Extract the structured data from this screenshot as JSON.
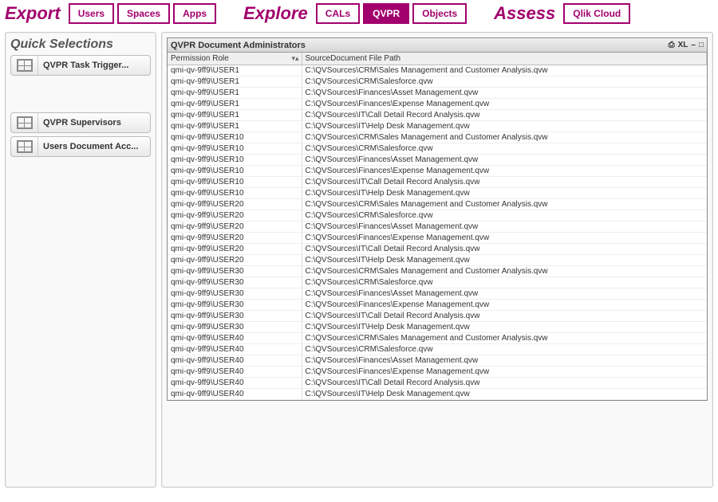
{
  "topbar": {
    "sections": [
      {
        "label": "Export",
        "buttons": [
          {
            "label": "Users",
            "active": false
          },
          {
            "label": "Spaces",
            "active": false
          },
          {
            "label": "Apps",
            "active": false
          }
        ]
      },
      {
        "label": "Explore",
        "buttons": [
          {
            "label": "CALs",
            "active": false
          },
          {
            "label": "QVPR",
            "active": true
          },
          {
            "label": "Objects",
            "active": false
          }
        ]
      },
      {
        "label": "Assess",
        "buttons": [
          {
            "label": "Qlik Cloud",
            "active": false
          }
        ]
      }
    ]
  },
  "sidebar": {
    "title": "Quick Selections",
    "items": [
      {
        "label": "QVPR Task Trigger..."
      },
      {
        "label": "QVPR Supervisors"
      },
      {
        "label": "Users Document Acc..."
      }
    ]
  },
  "table": {
    "title": "QVPR Document Administrators",
    "tools": [
      "⎙",
      "XL",
      "–",
      "□"
    ],
    "columns": [
      {
        "label": "Permission Role"
      },
      {
        "label": "SourceDocument File Path"
      }
    ],
    "rows": [
      [
        "qmi-qv-9ff9\\USER1",
        "C:\\QVSources\\CRM\\Sales Management and Customer Analysis.qvw"
      ],
      [
        "qmi-qv-9ff9\\USER1",
        "C:\\QVSources\\CRM\\Salesforce.qvw"
      ],
      [
        "qmi-qv-9ff9\\USER1",
        "C:\\QVSources\\Finances\\Asset Management.qvw"
      ],
      [
        "qmi-qv-9ff9\\USER1",
        "C:\\QVSources\\Finances\\Expense Management.qvw"
      ],
      [
        "qmi-qv-9ff9\\USER1",
        "C:\\QVSources\\IT\\Call Detail Record Analysis.qvw"
      ],
      [
        "qmi-qv-9ff9\\USER1",
        "C:\\QVSources\\IT\\Help Desk Management.qvw"
      ],
      [
        "qmi-qv-9ff9\\USER10",
        "C:\\QVSources\\CRM\\Sales Management and Customer Analysis.qvw"
      ],
      [
        "qmi-qv-9ff9\\USER10",
        "C:\\QVSources\\CRM\\Salesforce.qvw"
      ],
      [
        "qmi-qv-9ff9\\USER10",
        "C:\\QVSources\\Finances\\Asset Management.qvw"
      ],
      [
        "qmi-qv-9ff9\\USER10",
        "C:\\QVSources\\Finances\\Expense Management.qvw"
      ],
      [
        "qmi-qv-9ff9\\USER10",
        "C:\\QVSources\\IT\\Call Detail Record Analysis.qvw"
      ],
      [
        "qmi-qv-9ff9\\USER10",
        "C:\\QVSources\\IT\\Help Desk Management.qvw"
      ],
      [
        "qmi-qv-9ff9\\USER20",
        "C:\\QVSources\\CRM\\Sales Management and Customer Analysis.qvw"
      ],
      [
        "qmi-qv-9ff9\\USER20",
        "C:\\QVSources\\CRM\\Salesforce.qvw"
      ],
      [
        "qmi-qv-9ff9\\USER20",
        "C:\\QVSources\\Finances\\Asset Management.qvw"
      ],
      [
        "qmi-qv-9ff9\\USER20",
        "C:\\QVSources\\Finances\\Expense Management.qvw"
      ],
      [
        "qmi-qv-9ff9\\USER20",
        "C:\\QVSources\\IT\\Call Detail Record Analysis.qvw"
      ],
      [
        "qmi-qv-9ff9\\USER20",
        "C:\\QVSources\\IT\\Help Desk Management.qvw"
      ],
      [
        "qmi-qv-9ff9\\USER30",
        "C:\\QVSources\\CRM\\Sales Management and Customer Analysis.qvw"
      ],
      [
        "qmi-qv-9ff9\\USER30",
        "C:\\QVSources\\CRM\\Salesforce.qvw"
      ],
      [
        "qmi-qv-9ff9\\USER30",
        "C:\\QVSources\\Finances\\Asset Management.qvw"
      ],
      [
        "qmi-qv-9ff9\\USER30",
        "C:\\QVSources\\Finances\\Expense Management.qvw"
      ],
      [
        "qmi-qv-9ff9\\USER30",
        "C:\\QVSources\\IT\\Call Detail Record Analysis.qvw"
      ],
      [
        "qmi-qv-9ff9\\USER30",
        "C:\\QVSources\\IT\\Help Desk Management.qvw"
      ],
      [
        "qmi-qv-9ff9\\USER40",
        "C:\\QVSources\\CRM\\Sales Management and Customer Analysis.qvw"
      ],
      [
        "qmi-qv-9ff9\\USER40",
        "C:\\QVSources\\CRM\\Salesforce.qvw"
      ],
      [
        "qmi-qv-9ff9\\USER40",
        "C:\\QVSources\\Finances\\Asset Management.qvw"
      ],
      [
        "qmi-qv-9ff9\\USER40",
        "C:\\QVSources\\Finances\\Expense Management.qvw"
      ],
      [
        "qmi-qv-9ff9\\USER40",
        "C:\\QVSources\\IT\\Call Detail Record Analysis.qvw"
      ],
      [
        "qmi-qv-9ff9\\USER40",
        "C:\\QVSources\\IT\\Help Desk Management.qvw"
      ]
    ]
  }
}
